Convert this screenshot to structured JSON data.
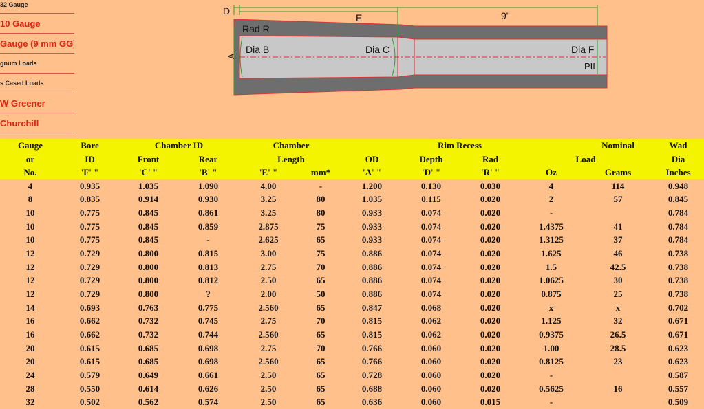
{
  "sidebar": {
    "items": [
      {
        "label": "32 Gauge",
        "size": "small"
      },
      {
        "label": "10 Gauge",
        "size": "big"
      },
      {
        "label": "Gauge (9 mm GG)",
        "size": "big"
      },
      {
        "label": "gnum Loads",
        "size": "small"
      },
      {
        "label": "s Cased Loads",
        "size": "small"
      },
      {
        "label": "W Greener",
        "size": "big"
      },
      {
        "label": "Churchill",
        "size": "big"
      }
    ]
  },
  "diagram": {
    "label_d": "D",
    "label_e": "E",
    "label_length": "9\"",
    "label_rad_r": "Rad R",
    "label_a": "A",
    "label_dia_b": "Dia B",
    "label_dia_c": "Dia C",
    "label_dia_f": "Dia F",
    "label_pii": "PII",
    "colors": {
      "barrel": "#6e6e6e",
      "bore": "#c8c8c8",
      "outline": "#e03030",
      "dimension": "#2aa02a"
    }
  },
  "table": {
    "header_row1": [
      "Gauge",
      "Bore",
      "Chamber ID",
      "Chamber",
      "",
      "Rim  Recess",
      "",
      "Nominal",
      "Wad"
    ],
    "header_row2": [
      "or",
      "ID",
      "Front",
      "Rear",
      "Length",
      "",
      "OD",
      "Depth",
      "Rad",
      "Load",
      "Dia"
    ],
    "header_row3": [
      "No.",
      "'F' \"",
      "'C' \"",
      "'B' \"",
      "'E' \"",
      "mm*",
      "'A' \"",
      "'D' \"",
      "'R' \"",
      "Oz",
      "Grams",
      "Inches"
    ],
    "rows": [
      [
        "4",
        "0.935",
        "1.035",
        "1.090",
        "4.00",
        "-",
        "1.200",
        "0.130",
        "0.030",
        "4",
        "114",
        "0.948"
      ],
      [
        "8",
        "0.835",
        "0.914",
        "0.930",
        "3.25",
        "80",
        "1.035",
        "0.115",
        "0.020",
        "2",
        "57",
        "0.845"
      ],
      [
        "10",
        "0.775",
        "0.845",
        "0.861",
        "3.25",
        "80",
        "0.933",
        "0.074",
        "0.020",
        "-",
        "",
        "0.784"
      ],
      [
        "10",
        "0.775",
        "0.845",
        "0.859",
        "2.875",
        "75",
        "0.933",
        "0.074",
        "0.020",
        "1.4375",
        "41",
        "0.784"
      ],
      [
        "10",
        "0.775",
        "0.845",
        "-",
        "2.625",
        "65",
        "0.933",
        "0.074",
        "0.020",
        "1.3125",
        "37",
        "0.784"
      ],
      [
        "12",
        "0.729",
        "0.800",
        "0.815",
        "3.00",
        "75",
        "0.886",
        "0.074",
        "0.020",
        "1.625",
        "46",
        "0.738"
      ],
      [
        "12",
        "0.729",
        "0.800",
        "0.813",
        "2.75",
        "70",
        "0.886",
        "0.074",
        "0.020",
        "1.5",
        "42.5",
        "0.738"
      ],
      [
        "12",
        "0.729",
        "0.800",
        "0.812",
        "2.50",
        "65",
        "0.886",
        "0.074",
        "0.020",
        "1.0625",
        "30",
        "0.738"
      ],
      [
        "12",
        "0.729",
        "0.800",
        "?",
        "2.00",
        "50",
        "0.886",
        "0.074",
        "0.020",
        "0.875",
        "25",
        "0.738"
      ],
      [
        "14",
        "0.693",
        "0.763",
        "0.775",
        "2.560",
        "65",
        "0.847",
        "0.068",
        "0.020",
        "x",
        "x",
        "0.702"
      ],
      [
        "16",
        "0.662",
        "0.732",
        "0.745",
        "2.75",
        "70",
        "0.815",
        "0.062",
        "0.020",
        "1.125",
        "32",
        "0.671"
      ],
      [
        "16",
        "0.662",
        "0.732",
        "0.744",
        "2.560",
        "65",
        "0.815",
        "0.062",
        "0.020",
        "0.9375",
        "26.5",
        "0.671"
      ],
      [
        "20",
        "0.615",
        "0.685",
        "0.698",
        "2.75",
        "70",
        "0.766",
        "0.060",
        "0.020",
        "1.00",
        "28.5",
        "0.623"
      ],
      [
        "20",
        "0.615",
        "0.685",
        "0.698",
        "2.560",
        "65",
        "0.766",
        "0.060",
        "0.020",
        "0.8125",
        "23",
        "0.623"
      ],
      [
        "24",
        "0.579",
        "0.649",
        "0.661",
        "2.50",
        "65",
        "0.728",
        "0.060",
        "0.020",
        "-",
        "",
        "0.587"
      ],
      [
        "28",
        "0.550",
        "0.614",
        "0.626",
        "2.50",
        "65",
        "0.688",
        "0.060",
        "0.020",
        "0.5625",
        "16",
        "0.557"
      ],
      [
        "32",
        "0.502",
        "0.562",
        "0.574",
        "2.50",
        "65",
        "0.636",
        "0.060",
        "0.015",
        "-",
        "",
        "0.509"
      ]
    ]
  }
}
